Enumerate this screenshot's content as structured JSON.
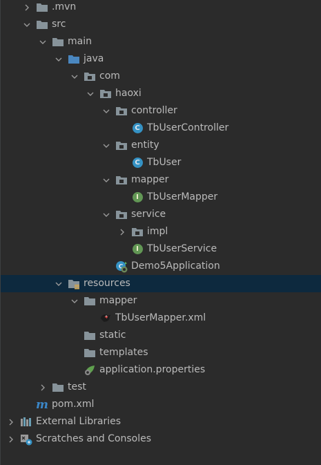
{
  "tree": [
    {
      "label": ".mvn",
      "depth": 1,
      "chevron": "right",
      "icon": "folder",
      "selected": false
    },
    {
      "label": "src",
      "depth": 1,
      "chevron": "down",
      "icon": "folder",
      "selected": false
    },
    {
      "label": "main",
      "depth": 2,
      "chevron": "down",
      "icon": "folder",
      "selected": false
    },
    {
      "label": "java",
      "depth": 3,
      "chevron": "down",
      "icon": "source-folder",
      "selected": false
    },
    {
      "label": "com",
      "depth": 4,
      "chevron": "down",
      "icon": "package",
      "selected": false
    },
    {
      "label": "haoxi",
      "depth": 5,
      "chevron": "down",
      "icon": "package",
      "selected": false
    },
    {
      "label": "controller",
      "depth": 6,
      "chevron": "down",
      "icon": "package",
      "selected": false
    },
    {
      "label": "TbUserController",
      "depth": 7,
      "chevron": "none",
      "icon": "class",
      "selected": false
    },
    {
      "label": "entity",
      "depth": 6,
      "chevron": "down",
      "icon": "package",
      "selected": false
    },
    {
      "label": "TbUser",
      "depth": 7,
      "chevron": "none",
      "icon": "class",
      "selected": false
    },
    {
      "label": "mapper",
      "depth": 6,
      "chevron": "down",
      "icon": "package",
      "selected": false
    },
    {
      "label": "TbUserMapper",
      "depth": 7,
      "chevron": "none",
      "icon": "interface",
      "selected": false
    },
    {
      "label": "service",
      "depth": 6,
      "chevron": "down",
      "icon": "package",
      "selected": false
    },
    {
      "label": "impl",
      "depth": 7,
      "chevron": "right",
      "icon": "package",
      "selected": false
    },
    {
      "label": "TbUserService",
      "depth": 7,
      "chevron": "none",
      "icon": "interface",
      "selected": false
    },
    {
      "label": "Demo5Application",
      "depth": 6,
      "chevron": "none",
      "icon": "spring-boot-class",
      "selected": false
    },
    {
      "label": "resources",
      "depth": 3,
      "chevron": "down",
      "icon": "resources-folder",
      "selected": true
    },
    {
      "label": "mapper",
      "depth": 4,
      "chevron": "down",
      "icon": "folder",
      "selected": false
    },
    {
      "label": "TbUserMapper.xml",
      "depth": 5,
      "chevron": "none",
      "icon": "mybatis-xml",
      "selected": false
    },
    {
      "label": "static",
      "depth": 4,
      "chevron": "none",
      "icon": "folder",
      "selected": false
    },
    {
      "label": "templates",
      "depth": 4,
      "chevron": "none",
      "icon": "folder",
      "selected": false
    },
    {
      "label": "application.properties",
      "depth": 4,
      "chevron": "none",
      "icon": "spring-properties",
      "selected": false
    },
    {
      "label": "test",
      "depth": 2,
      "chevron": "right",
      "icon": "folder",
      "selected": false
    },
    {
      "label": "pom.xml",
      "depth": 1,
      "chevron": "none",
      "icon": "maven",
      "selected": false
    },
    {
      "label": "External Libraries",
      "depth": 0,
      "chevron": "right",
      "icon": "libraries",
      "selected": false
    },
    {
      "label": "Scratches and Consoles",
      "depth": 0,
      "chevron": "right",
      "icon": "scratches",
      "selected": false
    }
  ],
  "colors": {
    "background": "#2b2b2b",
    "selection": "#0d293e",
    "text": "#bbbbbb",
    "folder": "#87939a",
    "source_folder": "#4a87c0",
    "class_icon": "#3592c4",
    "interface_icon": "#629755"
  }
}
